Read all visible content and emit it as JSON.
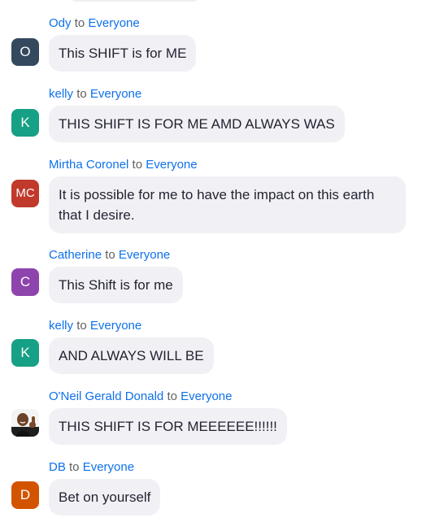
{
  "chat": {
    "to_word": "to",
    "messages": [
      {
        "sender": "Ody",
        "recipient": "Everyone",
        "avatar_initials": "O",
        "avatar_color": "#34495e",
        "text": "This SHIFT is for ME"
      },
      {
        "sender": "kelly",
        "recipient": "Everyone",
        "avatar_initials": "K",
        "avatar_color": "#16a085",
        "text": "THIS SHIFT IS FOR ME AMD ALWAYS WAS"
      },
      {
        "sender": "Mirtha Coronel",
        "recipient": "Everyone",
        "avatar_initials": "MC",
        "avatar_color": "#c0392b",
        "text": "It is possible for me to have the impact on this earth that I desire."
      },
      {
        "sender": "Catherine",
        "recipient": "Everyone",
        "avatar_initials": "C",
        "avatar_color": "#8e44ad",
        "text": "This Shift is for me"
      },
      {
        "sender": "kelly",
        "recipient": "Everyone",
        "avatar_initials": "K",
        "avatar_color": "#16a085",
        "text": "AND ALWAYS WILL BE"
      },
      {
        "sender": "O'Neil Gerald Donald",
        "recipient": "Everyone",
        "avatar_initials": "",
        "avatar_color": "#2c2c2c",
        "text": "THIS SHIFT IS FOR MEEEEEE!!!!!!"
      },
      {
        "sender": "DB",
        "recipient": "Everyone",
        "avatar_initials": "D",
        "avatar_color": "#d35400",
        "text": "Bet on yourself"
      }
    ]
  }
}
